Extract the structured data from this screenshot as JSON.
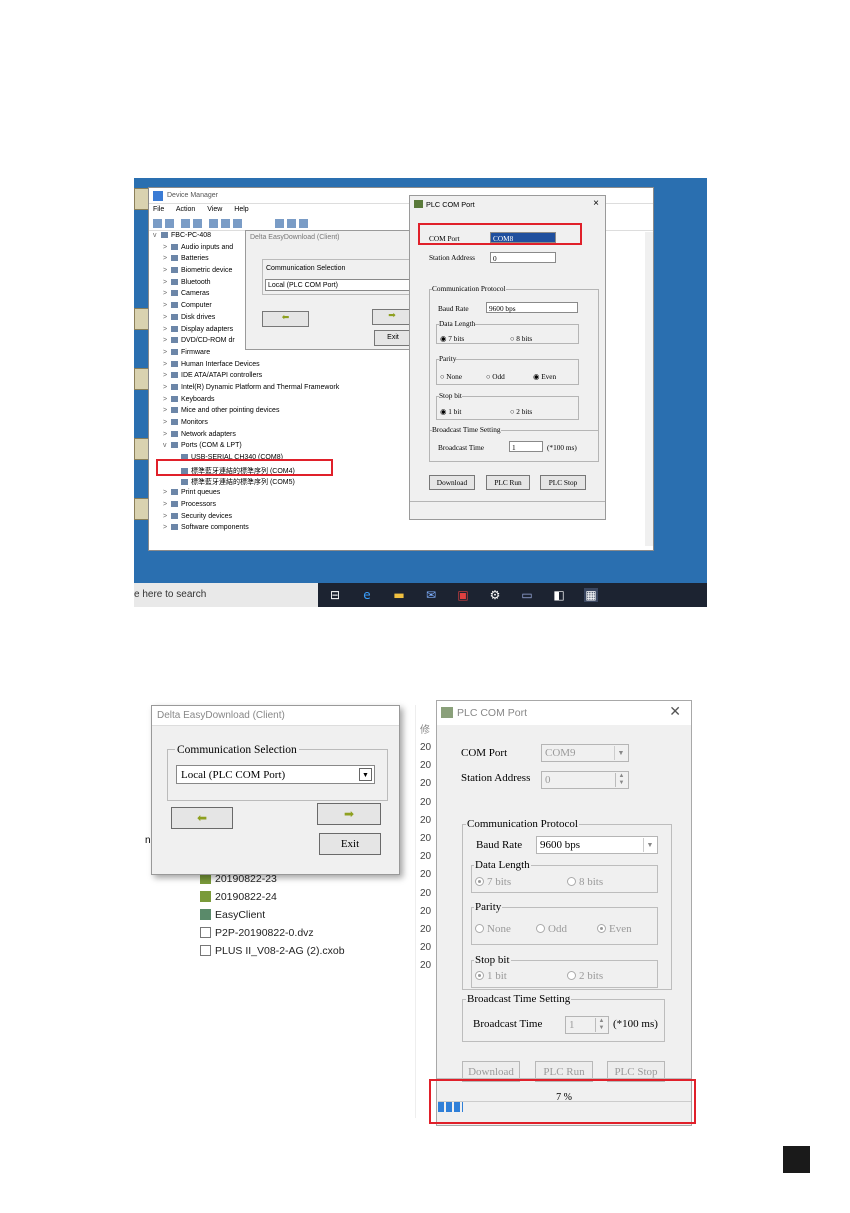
{
  "shot1": {
    "taskbar": {
      "search_text": "e here to search"
    },
    "device_manager": {
      "title": "Device Manager",
      "menu": [
        "File",
        "Action",
        "View",
        "Help"
      ],
      "tree": [
        {
          "label": "FBC-PC-408",
          "level": 0,
          "expander": "v"
        },
        {
          "label": "Audio inputs and",
          "level": 1,
          "expander": ">"
        },
        {
          "label": "Batteries",
          "level": 1,
          "expander": ">"
        },
        {
          "label": "Biometric device",
          "level": 1,
          "expander": ">"
        },
        {
          "label": "Bluetooth",
          "level": 1,
          "expander": ">"
        },
        {
          "label": "Cameras",
          "level": 1,
          "expander": ">"
        },
        {
          "label": "Computer",
          "level": 1,
          "expander": ">"
        },
        {
          "label": "Disk drives",
          "level": 1,
          "expander": ">"
        },
        {
          "label": "Display adapters",
          "level": 1,
          "expander": ">"
        },
        {
          "label": "DVD/CD-ROM dr",
          "level": 1,
          "expander": ">"
        },
        {
          "label": "Firmware",
          "level": 1,
          "expander": ">"
        },
        {
          "label": "Human Interface Devices",
          "level": 1,
          "expander": ">"
        },
        {
          "label": "IDE ATA/ATAPI controllers",
          "level": 1,
          "expander": ">"
        },
        {
          "label": "Intel(R) Dynamic Platform and Thermal Framework",
          "level": 1,
          "expander": ">"
        },
        {
          "label": "Keyboards",
          "level": 1,
          "expander": ">"
        },
        {
          "label": "Mice and other pointing devices",
          "level": 1,
          "expander": ">"
        },
        {
          "label": "Monitors",
          "level": 1,
          "expander": ">"
        },
        {
          "label": "Network adapters",
          "level": 1,
          "expander": ">"
        },
        {
          "label": "Ports (COM & LPT)",
          "level": 1,
          "expander": "v"
        },
        {
          "label": "USB-SERIAL CH340 (COM8)",
          "level": 2,
          "expander": ""
        },
        {
          "label": "標準藍牙連結的標準序列 (COM4)",
          "level": 2,
          "expander": ""
        },
        {
          "label": "標準藍牙連結的標準序列 (COM5)",
          "level": 2,
          "expander": ""
        },
        {
          "label": "Print queues",
          "level": 1,
          "expander": ">"
        },
        {
          "label": "Processors",
          "level": 1,
          "expander": ">"
        },
        {
          "label": "Security devices",
          "level": 1,
          "expander": ">"
        },
        {
          "label": "Software components",
          "level": 1,
          "expander": ">"
        }
      ]
    },
    "easydownload": {
      "title": "Delta EasyDownload (Client)",
      "group_label": "Communication Selection",
      "selection": "Local (PLC COM Port)",
      "exit_label": "Exit"
    },
    "plc_com_port": {
      "title": "PLC COM Port",
      "com_port_label": "COM Port",
      "com_port_value": "COM8",
      "station_label": "Station Address",
      "station_value": "0",
      "protocol_label": "Communication Protocol",
      "baud_label": "Baud Rate",
      "baud_value": "9600 bps",
      "data_length_label": "Data Length",
      "bits7": "7 bits",
      "bits8": "8 bits",
      "parity_label": "Parity",
      "none": "None",
      "odd": "Odd",
      "even": "Even",
      "stop_label": "Stop bit",
      "bit1": "1 bit",
      "bits2": "2 bits",
      "broadcast_group": "Broadcast Time Setting",
      "broadcast_label": "Broadcast Time",
      "broadcast_value": "1",
      "broadcast_unit": "(*100 ms)",
      "download": "Download",
      "plc_run": "PLC Run",
      "plc_stop": "PLC Stop"
    }
  },
  "shot2": {
    "easydownload": {
      "title": "Delta EasyDownload (Client)",
      "group_label": "Communication Selection",
      "selection": "Local (PLC COM Port)",
      "exit_label": "Exit"
    },
    "explorer": {
      "left_fragment": "n,",
      "files": [
        "20190822-23",
        "20190822-24",
        "EasyClient",
        "P2P-20190822-0.dvz",
        "PLUS II_V08-2-AG (2).cxob"
      ],
      "date_col_header": "修",
      "date_prefix": [
        "20",
        "20",
        "20",
        "20",
        "20",
        "20",
        "20",
        "20",
        "20",
        "20",
        "20",
        "20",
        "20"
      ]
    },
    "plc_com_port": {
      "title": "PLC COM Port",
      "com_port_label": "COM Port",
      "com_port_value": "COM9",
      "station_label": "Station Address",
      "station_value": "0",
      "protocol_label": "Communication Protocol",
      "baud_label": "Baud Rate",
      "baud_value": "9600 bps",
      "data_length_label": "Data Length",
      "bits7": "7 bits",
      "bits8": "8 bits",
      "parity_label": "Parity",
      "none": "None",
      "odd": "Odd",
      "even": "Even",
      "stop_label": "Stop bit",
      "bit1": "1 bit",
      "bits2": "2 bits",
      "broadcast_group": "Broadcast Time Setting",
      "broadcast_label": "Broadcast Time",
      "broadcast_value": "1",
      "broadcast_unit": "(*100 ms)",
      "download": "Download",
      "plc_run": "PLC Run",
      "plc_stop": "PLC Stop",
      "progress_text": "7 %",
      "progress_fraction": 0.07
    }
  },
  "colors": {
    "highlight": "#e0202a",
    "desktop": "#2a6fb0",
    "progress": "#2f7fd8"
  }
}
